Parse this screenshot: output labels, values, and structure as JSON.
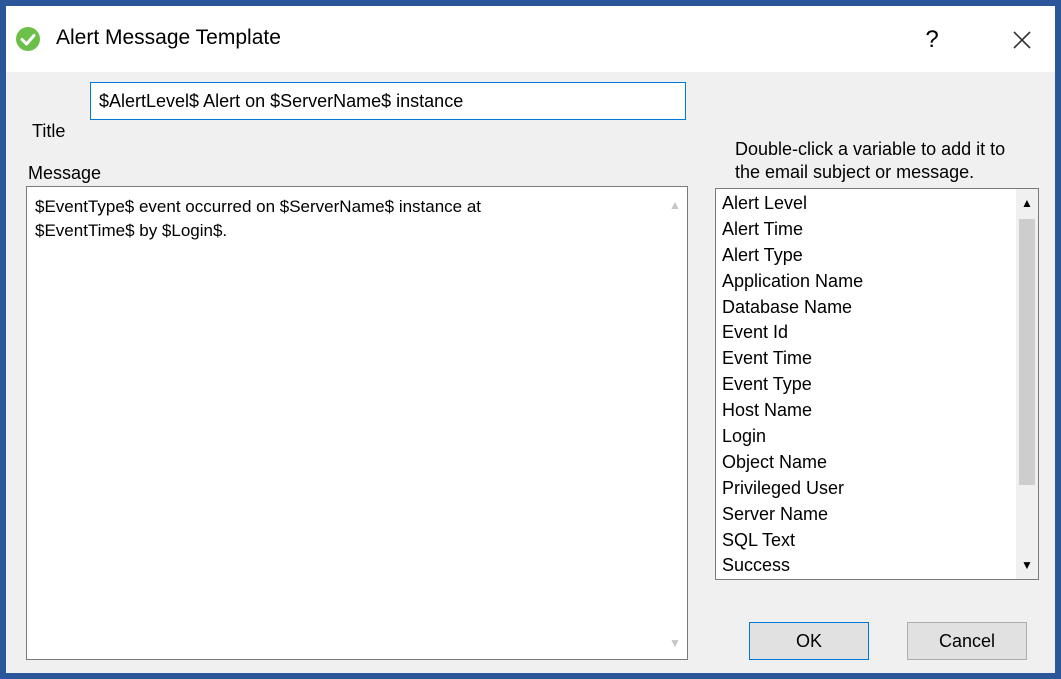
{
  "window": {
    "title": "Alert Message Template",
    "help_label": "?"
  },
  "form": {
    "title_label": "Title",
    "title_value": "$AlertLevel$ Alert on $ServerName$ instance",
    "message_label": "Message",
    "message_value": "$EventType$ event occurred on $ServerName$ instance at\n$EventTime$ by $Login$.",
    "hint_line1": "Double-click a variable to add it to",
    "hint_line2": "the email subject or message."
  },
  "variables": [
    "Alert Level",
    "Alert Time",
    "Alert Type",
    "Application Name",
    "Database Name",
    "Event Id",
    "Event Time",
    "Event Type",
    "Host Name",
    "Login",
    "Object Name",
    "Privileged User",
    "Server Name",
    "SQL Text",
    "Success"
  ],
  "buttons": {
    "ok_label": "OK",
    "cancel_label": "Cancel"
  },
  "colors": {
    "window_border": "#2b579a",
    "app_icon": "#6cc04a",
    "focus_accent": "#0078d7"
  }
}
